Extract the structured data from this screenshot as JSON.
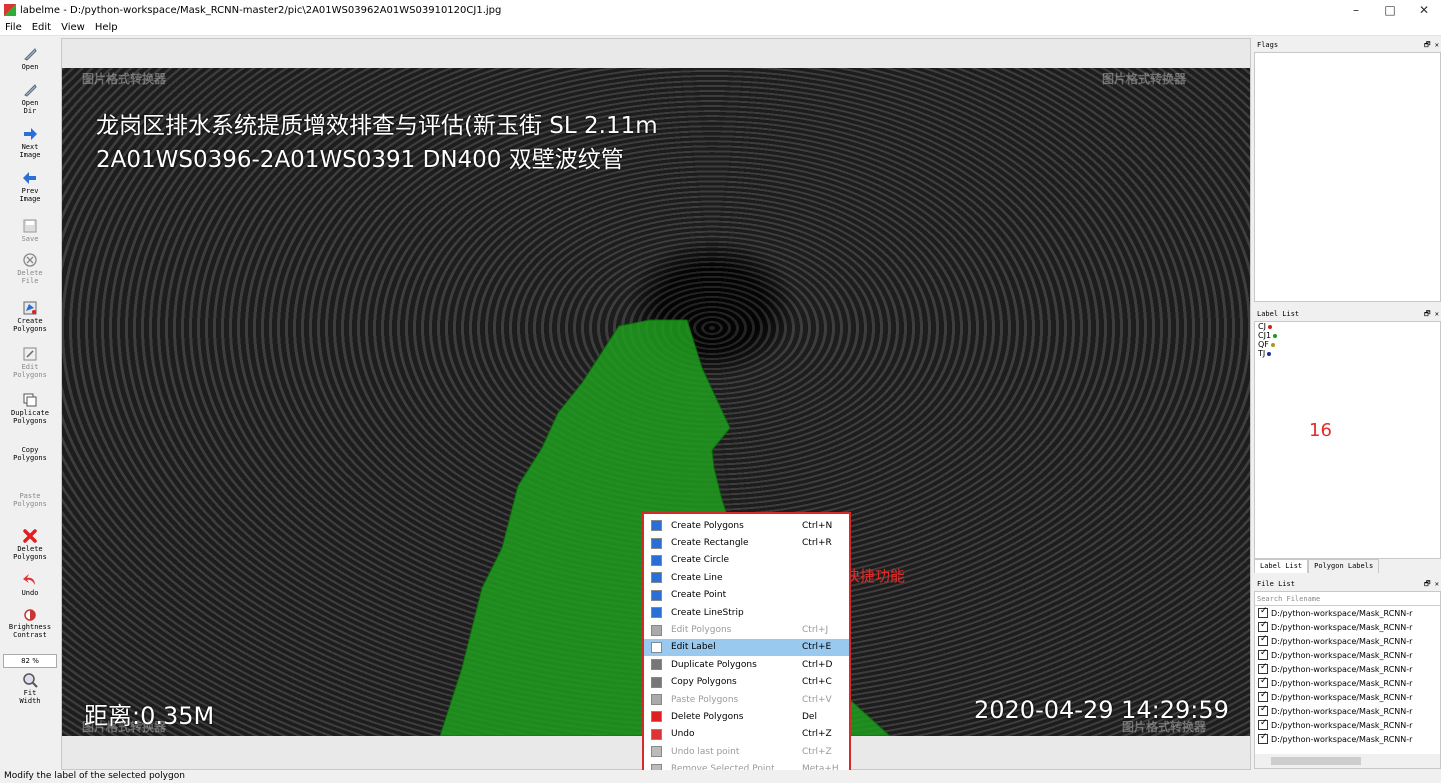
{
  "window": {
    "title": "labelme - D:/python-workspace/Mask_RCNN-master2/pic\\2A01WS03962A01WS03910120CJ1.jpg",
    "controls": [
      "–",
      "□",
      "✕"
    ]
  },
  "menu": [
    "File",
    "Edit",
    "View",
    "Help"
  ],
  "toolbar": {
    "open": "Open",
    "open_dir": "Open\nDir",
    "next_image": "Next\nImage",
    "prev_image": "Prev\nImage",
    "save": "Save",
    "delete_file": "Delete\nFile",
    "create_polygons": "Create\nPolygons",
    "edit_polygons": "Edit\nPolygons",
    "duplicate_polygons": "Duplicate\nPolygons",
    "copy_polygons": "Copy\nPolygons",
    "paste_polygons": "Paste\nPolygons",
    "delete_polygons": "Delete\nPolygons",
    "undo": "Undo",
    "brightness_contrast": "Brightness\nContrast",
    "zoom": "82 %",
    "fit_width": "Fit\nWidth"
  },
  "image_overlay": {
    "line1": "龙岗区排水系统提质增效排查与评估(新玉街 SL 2.11m",
    "line2": "2A01WS0396-2A01WS0391  DN400  双壁波纹管",
    "distance": "距离:0.35M",
    "timestamp": "2020-04-29  14:29:59",
    "watermark": "图片格式转换器"
  },
  "context_menu": {
    "items": [
      {
        "label": "Create Polygons",
        "shortcut": "Ctrl+N",
        "enabled": true
      },
      {
        "label": "Create Rectangle",
        "shortcut": "Ctrl+R",
        "enabled": true
      },
      {
        "label": "Create Circle",
        "shortcut": "",
        "enabled": true
      },
      {
        "label": "Create Line",
        "shortcut": "",
        "enabled": true
      },
      {
        "label": "Create Point",
        "shortcut": "",
        "enabled": true
      },
      {
        "label": "Create LineStrip",
        "shortcut": "",
        "enabled": true
      },
      {
        "label": "Edit Polygons",
        "shortcut": "Ctrl+J",
        "enabled": false
      },
      {
        "label": "Edit Label",
        "shortcut": "Ctrl+E",
        "enabled": true,
        "highlighted": true
      },
      {
        "label": "Duplicate Polygons",
        "shortcut": "Ctrl+D",
        "enabled": true
      },
      {
        "label": "Copy Polygons",
        "shortcut": "Ctrl+C",
        "enabled": true
      },
      {
        "label": "Paste Polygons",
        "shortcut": "Ctrl+V",
        "enabled": false
      },
      {
        "label": "Delete Polygons",
        "shortcut": "Del",
        "enabled": true
      },
      {
        "label": "Undo",
        "shortcut": "Ctrl+Z",
        "enabled": true
      },
      {
        "label": "Undo last point",
        "shortcut": "Ctrl+Z",
        "enabled": false
      },
      {
        "label": "Remove Selected Point",
        "shortcut": "Meta+H",
        "enabled": false
      }
    ]
  },
  "annotation_text": "右键菜单会弹出快捷功能",
  "annotation_number": "16",
  "flags": {
    "title": "Flags"
  },
  "label_list": {
    "title": "Label List",
    "items": [
      {
        "label": "CJ",
        "color": "#d02020"
      },
      {
        "label": "CJ1",
        "color": "#1a9a1a"
      },
      {
        "label": "QF",
        "color": "#b09a10"
      },
      {
        "label": "TJ",
        "color": "#1a2aa0"
      }
    ]
  },
  "tabs": [
    "Label List",
    "Polygon Labels"
  ],
  "file_list": {
    "title": "File List",
    "search_placeholder": "Search Filename",
    "items": [
      "D:/python-workspace/Mask_RCNN-r",
      "D:/python-workspace/Mask_RCNN-r",
      "D:/python-workspace/Mask_RCNN-r",
      "D:/python-workspace/Mask_RCNN-r",
      "D:/python-workspace/Mask_RCNN-r",
      "D:/python-workspace/Mask_RCNN-r",
      "D:/python-workspace/Mask_RCNN-r",
      "D:/python-workspace/Mask_RCNN-r",
      "D:/python-workspace/Mask_RCNN-r",
      "D:/python-workspace/Mask_RCNN-r"
    ]
  },
  "status": "Modify the label of the selected polygon",
  "colors": {
    "polygon_fill": "#1e9e1e",
    "highlight": "#99c9ef",
    "accent_red": "#e32b2b"
  }
}
